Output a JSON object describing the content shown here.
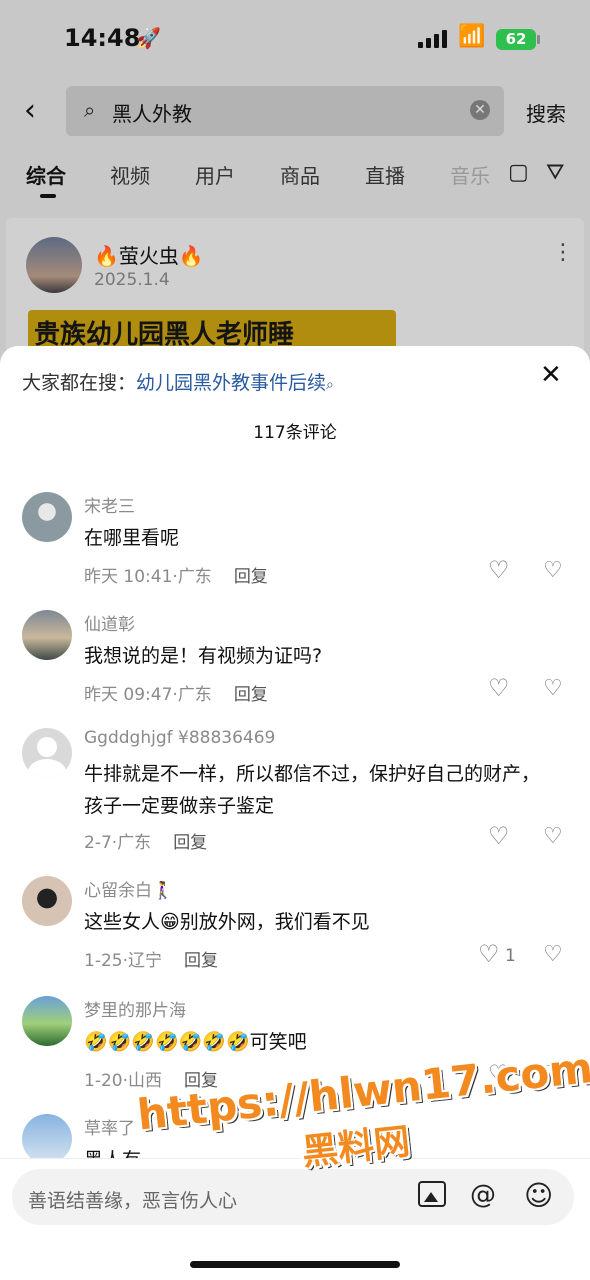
{
  "status_bar": {
    "time": "14:48",
    "battery": "62"
  },
  "search": {
    "query": "黑人外教",
    "button": "搜索"
  },
  "tabs": [
    "综合",
    "视频",
    "用户",
    "商品",
    "直播",
    "音乐"
  ],
  "background_post": {
    "author": "🔥萤火虫🔥",
    "date": "2025.1.4",
    "banner_text": "贵族幼儿园黑人老师睡"
  },
  "sheet": {
    "suggest_prefix": "大家都在搜：",
    "suggest_link": "幼儿园黑外教事件后续",
    "comment_count": "117条评论",
    "comments": [
      {
        "name": "宋老三",
        "text": "在哪里看呢",
        "date": "昨天 10:41",
        "location": "广东",
        "reply": "回复",
        "likes": ""
      },
      {
        "name": "仙道彰",
        "text": "我想说的是！有视频为证吗?",
        "date": "昨天 09:47",
        "location": "广东",
        "reply": "回复",
        "likes": ""
      },
      {
        "name": "Ggddghjgf ¥88836469",
        "text": "牛排就是不一样，所以都信不过，保护好自己的财产，孩子一定要做亲子鉴定",
        "date": "2-7",
        "location": "广东",
        "reply": "回复",
        "likes": ""
      },
      {
        "name": "心留余白🚶‍♀️",
        "text": "这些女人😁别放外网，我们看不见",
        "date": "1-25",
        "location": "辽宁",
        "reply": "回复",
        "likes": "1"
      },
      {
        "name": "梦里的那片海",
        "text": "🤣🤣🤣🤣🤣🤣🤣可笑吧",
        "date": "1-20",
        "location": "山西",
        "reply": "回复",
        "likes": ""
      },
      {
        "name": "草率了",
        "text": "黑人有",
        "date": "",
        "location": "",
        "reply": "",
        "likes": ""
      }
    ],
    "input_placeholder": "善语结善缘，恶言伤人心"
  },
  "watermark": {
    "url": "https://hlwn17.com",
    "name": "黑料网"
  }
}
